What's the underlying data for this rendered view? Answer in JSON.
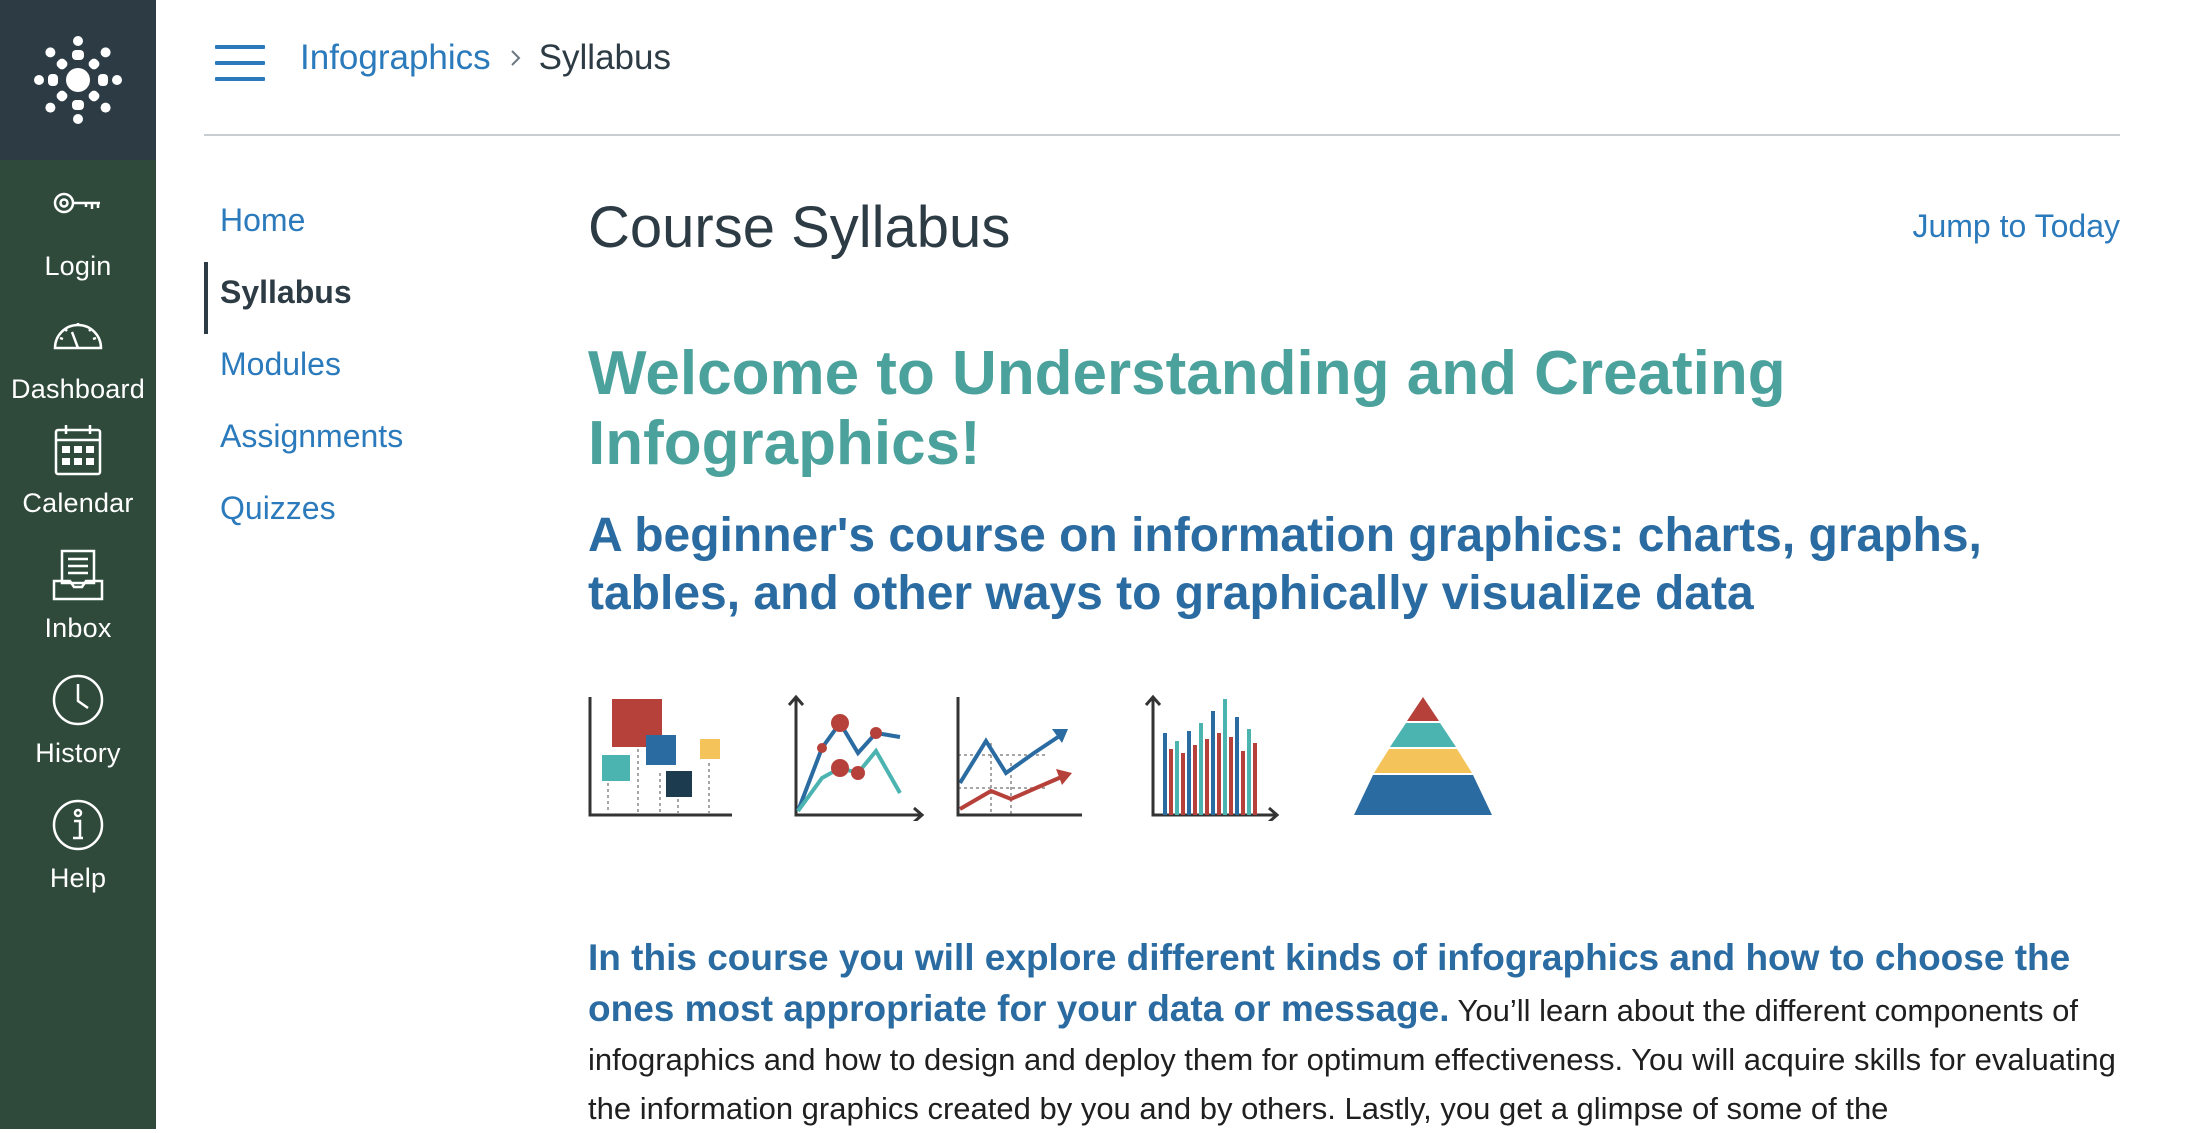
{
  "global_nav": {
    "items": [
      {
        "id": "login",
        "label": "Login",
        "icon": "key-icon"
      },
      {
        "id": "dashboard",
        "label": "Dashboard",
        "icon": "speedometer-icon"
      },
      {
        "id": "calendar",
        "label": "Calendar",
        "icon": "calendar-icon"
      },
      {
        "id": "inbox",
        "label": "Inbox",
        "icon": "inbox-icon"
      },
      {
        "id": "history",
        "label": "History",
        "icon": "clock-icon"
      },
      {
        "id": "help",
        "label": "Help",
        "icon": "info-icon"
      }
    ]
  },
  "header": {
    "breadcrumb": {
      "course": "Infographics",
      "current": "Syllabus"
    }
  },
  "course_nav": {
    "items": [
      {
        "label": "Home",
        "active": false
      },
      {
        "label": "Syllabus",
        "active": true
      },
      {
        "label": "Modules",
        "active": false
      },
      {
        "label": "Assignments",
        "active": false
      },
      {
        "label": "Quizzes",
        "active": false
      }
    ]
  },
  "main": {
    "title": "Course Syllabus",
    "jump_link": "Jump to Today",
    "welcome_heading": "Welcome to Understanding and Creating Infographics!",
    "subtitle": "A beginner's course on information graphics: charts, graphs, tables, and other ways to graphically visualize data",
    "intro_bold": "In this course you will explore different kinds of infographics and how to choose the ones most appropriate for your data or message.",
    "intro_text": " You’ll learn about the different components of infographics and how to design and deploy them for optimum effectiveness. You will acquire skills for evaluating the information graphics created by you and by others. Lastly, you get a glimpse of some of the"
  },
  "colors": {
    "nav_background": "#2f4a3b",
    "logo_background": "#2d3b45",
    "link": "#2b7abc",
    "welcome_teal": "#4ba19b",
    "heading_blue": "#2a6ba2",
    "chart_red": "#b6413a",
    "chart_teal": "#4bb3b0",
    "chart_navy": "#2a6ba2",
    "chart_yellow": "#f4c35a"
  }
}
